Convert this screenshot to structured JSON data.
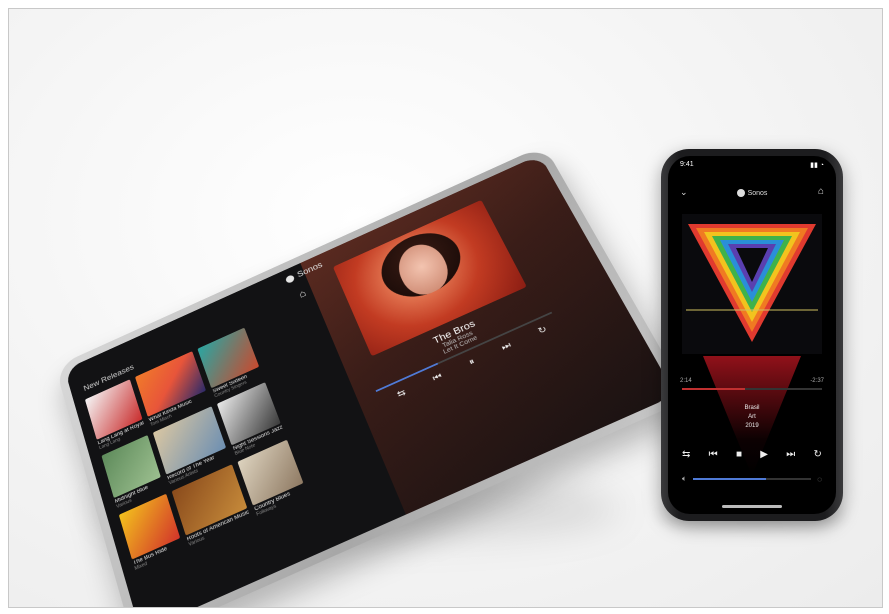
{
  "tablet": {
    "brand": "Sonos",
    "section_title": "New Releases",
    "tiles": [
      {
        "title": "Lang Lang at Royal",
        "subtitle": "Lang Lang"
      },
      {
        "title": "What Kinda Music",
        "subtitle": "Tom Misch"
      },
      {
        "title": "Sweet Sixteen",
        "subtitle": "Country Singers"
      },
      {
        "title": "Midnight Blue",
        "subtitle": "Various"
      },
      {
        "title": "Record of The Year",
        "subtitle": "Various Artists"
      },
      {
        "title": "Night Sessions Jazz",
        "subtitle": "Blue Note"
      },
      {
        "title": "The Bus Ride",
        "subtitle": "Mixed"
      },
      {
        "title": "Roots of American Music",
        "subtitle": "Various"
      },
      {
        "title": "Country Blues",
        "subtitle": "Folkways"
      }
    ],
    "now_playing": {
      "title": "The Bros",
      "artist": "Talia Ross",
      "album": "Let It Come"
    },
    "progress_fraction": 0.35,
    "controls": [
      "⇆",
      "⏮",
      "⏸",
      "⏭",
      "↻"
    ]
  },
  "phone": {
    "time": "9:41",
    "status_icons": "▮▮ ◔",
    "brand": "Sonos",
    "times": {
      "elapsed": "2:14",
      "remaining": "-2:37"
    },
    "progress_fraction": 0.45,
    "track_lines": [
      "Brasil",
      "Art",
      "2019"
    ],
    "controls": [
      "⇆",
      "⏮",
      "■",
      "▶",
      "⏭",
      "↻"
    ],
    "volume_fraction": 0.62
  }
}
